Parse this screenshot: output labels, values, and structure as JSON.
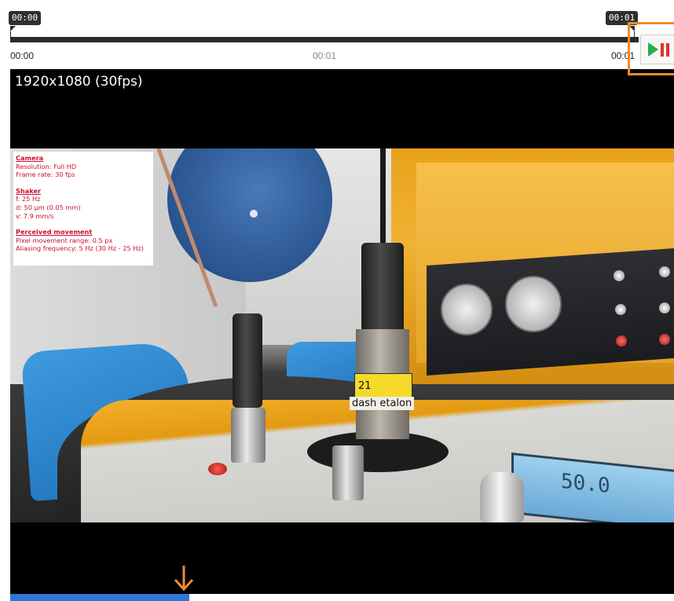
{
  "timeline": {
    "start_badge": "00:00",
    "end_badge": "00:01",
    "scale_left": "00:00",
    "scale_mid": "00:01",
    "scale_right": "00:01"
  },
  "controls": {
    "play_pause_icon": "play-pause-icon",
    "highlight_color": "#f08a2c",
    "play_color": "#21b24a",
    "pause_color": "#e0342a"
  },
  "video": {
    "resolution_label": "1920x1080 (30fps)",
    "sensor_label": "dash etalon",
    "sensor_tag": "21",
    "display_value": "50.0"
  },
  "info_overlay": {
    "camera_heading": "Camera",
    "camera_resolution": "Resolution: Full HD",
    "camera_frame_rate": "Frame rate: 30 fps",
    "shaker_heading": "Shaker",
    "shaker_f": "f: 25 Hz",
    "shaker_d": "d: 50 µm (0.05 mm)",
    "shaker_v": "v: 7.9 mm/s",
    "movement_heading": "Perceived movement",
    "movement_range": "Pixel movement range: 0.5 px",
    "movement_aliasing": "Aliasing frequency: 5 Hz (30 Hz - 25 Hz)",
    "text_color": "#c8102e"
  },
  "playback": {
    "progress_fraction": 0.27,
    "progress_color": "#2d77d6",
    "arrow_color": "#f08a2c"
  }
}
